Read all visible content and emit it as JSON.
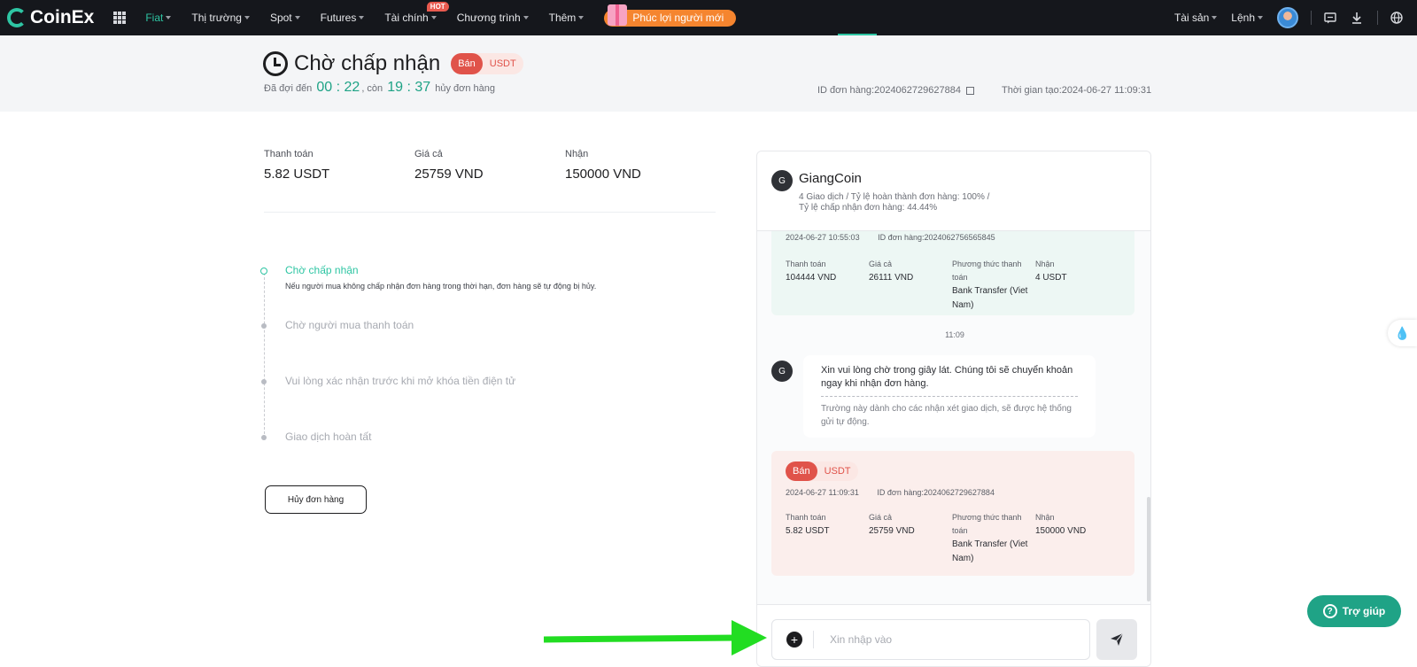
{
  "topbar": {
    "brand": "CoinEx",
    "nav": [
      {
        "label": "Fiat",
        "active": true
      },
      {
        "label": "Thị trường"
      },
      {
        "label": "Spot"
      },
      {
        "label": "Futures"
      },
      {
        "label": "Tài chính",
        "badge": "HOT"
      },
      {
        "label": "Chương trình"
      },
      {
        "label": "Thêm"
      }
    ],
    "promo": "Phúc lợi người mới",
    "assets": "Tài sản",
    "orders": "Lệnh"
  },
  "header": {
    "title": "Chờ chấp nhận",
    "side": "Bán",
    "coin": "USDT",
    "wait_prefix": "Đã đợi đến",
    "wait_time": "00 : 22",
    "remain_prefix": ", còn",
    "remain_time": "19 : 37",
    "remain_suffix": "hủy đơn hàng",
    "order_id": "ID đơn hàng:2024062729627884",
    "created": "Thời gian tạo:2024-06-27 11:09:31"
  },
  "summary": [
    {
      "label": "Thanh toán",
      "value": "5.82 USDT"
    },
    {
      "label": "Giá cả",
      "value": "25759 VND"
    },
    {
      "label": "Nhận",
      "value": "150000 VND"
    }
  ],
  "steps": [
    {
      "title": "Chờ chấp nhận",
      "desc": "Nếu người mua không chấp nhận đơn hàng trong thời hạn, đơn hàng sẽ tự động bị hủy."
    },
    {
      "title": "Chờ người mua thanh toán"
    },
    {
      "title": "Vui lòng xác nhận trước khi mở khóa tiền điện tử"
    },
    {
      "title": "Giao dịch hoàn tất"
    }
  ],
  "cancel_button": "Hủy đơn hàng",
  "chat": {
    "avatar": "G",
    "name": "GiangCoin",
    "stats_line1": "4 Giao dịch   /   Tỷ lệ hoàn thành đơn hàng: 100%   /",
    "stats_line2": "Tỷ lệ chấp nhận đơn hàng: 44.44%",
    "prev_order": {
      "time": "2024-06-27 10:55:03",
      "id": "ID đơn hàng:2024062756565845",
      "pay_label": "Thanh toán",
      "pay": "104444 VND",
      "price_label": "Giá cả",
      "price": "26111 VND",
      "method_label": "Phương thức thanh toán",
      "method": "Bank Transfer (Viet Nam)",
      "recv_label": "Nhận",
      "recv": "4 USDT"
    },
    "time_marker": "11:09",
    "message": {
      "avatar": "G",
      "text": "Xin vui lòng chờ trong giây lát. Chúng tôi sẽ chuyển khoản ngay khi nhận đơn hàng.",
      "note": "Trường này dành cho các nhận xét giao dịch, sẽ được hệ thống gửi tự động."
    },
    "cur_order": {
      "side": "Bán",
      "coin": "USDT",
      "time": "2024-06-27 11:09:31",
      "id": "ID đơn hàng:2024062729627884",
      "pay_label": "Thanh toán",
      "pay": "5.82 USDT",
      "price_label": "Giá cả",
      "price": "25759 VND",
      "method_label": "Phương thức thanh toán",
      "method": "Bank Transfer (Viet Nam)",
      "recv_label": "Nhận",
      "recv": "150000 VND"
    },
    "input_placeholder": "Xin nhập vào"
  },
  "help_button": "Trợ giúp",
  "colors": {
    "accent": "#2ec5a3",
    "sell": "#e0534a",
    "arrow": "#22dd22",
    "topbar": "#15171c"
  },
  "icons": [
    "apps-grid-icon",
    "gift-icon",
    "avatar",
    "chat-icon",
    "download-icon",
    "globe-icon",
    "clock-icon",
    "copy-icon",
    "plus-icon",
    "send-icon",
    "help-icon",
    "water-drop-icon"
  ]
}
